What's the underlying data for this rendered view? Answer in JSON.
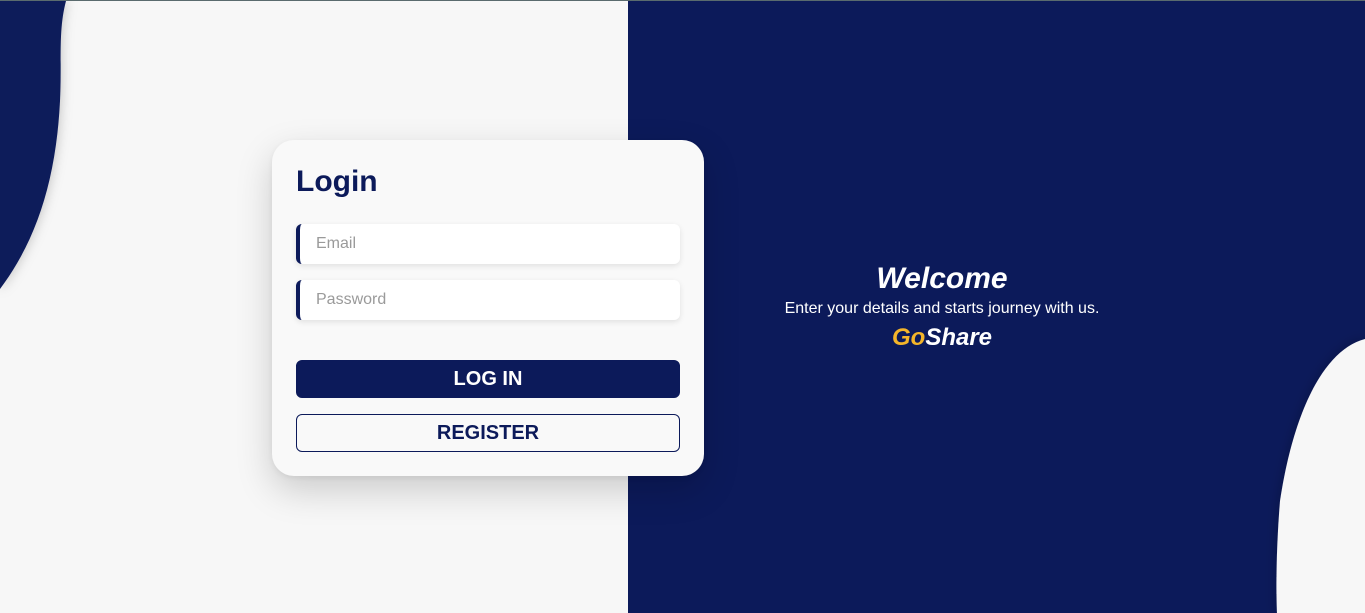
{
  "colors": {
    "navy": "#0c1a5a",
    "background": "#f7f7f7",
    "accent": "#f4b52a"
  },
  "login": {
    "title": "Login",
    "email_placeholder": "Email",
    "password_placeholder": "Password",
    "login_button": "LOG IN",
    "register_button": "REGISTER"
  },
  "welcome": {
    "title": "Welcome",
    "subtitle": "Enter your details and starts journey with us.",
    "brand_first": "Go",
    "brand_second": "Share"
  }
}
